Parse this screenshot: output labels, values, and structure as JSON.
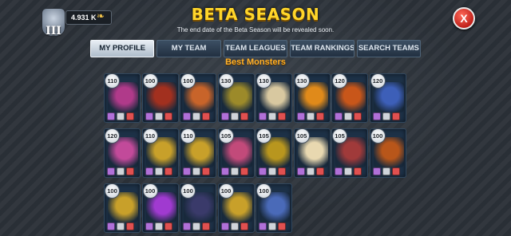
{
  "header": {
    "rank_roman": "III",
    "trophies": "4.931 K",
    "title": "BETA SEASON",
    "subtitle": "The end date of the Beta Season will be revealed soon.",
    "close_label": "X"
  },
  "tabs": [
    {
      "label": "MY PROFILE",
      "active": true
    },
    {
      "label": "MY TEAM",
      "active": false
    },
    {
      "label": "TEAM LEAGUES",
      "active": false
    },
    {
      "label": "TEAM RANKINGS",
      "active": false
    },
    {
      "label": "SEARCH TEAMS",
      "active": false
    }
  ],
  "section_title": "Best Monsters",
  "monsters": [
    {
      "level": "110",
      "color": "#b03a8a"
    },
    {
      "level": "100",
      "color": "#a2301f"
    },
    {
      "level": "100",
      "color": "#c8642a"
    },
    {
      "level": "130",
      "color": "#9c8a2a"
    },
    {
      "level": "130",
      "color": "#d8c8a0"
    },
    {
      "level": "130",
      "color": "#e08a1a"
    },
    {
      "level": "120",
      "color": "#c8561a"
    },
    {
      "level": "120",
      "color": "#3d5fb8"
    },
    {
      "level": "120",
      "color": "#c24a9a"
    },
    {
      "level": "110",
      "color": "#c8a02a"
    },
    {
      "level": "110",
      "color": "#c8a02a"
    },
    {
      "level": "105",
      "color": "#c24a7a"
    },
    {
      "level": "105",
      "color": "#b8961e"
    },
    {
      "level": "105",
      "color": "#e8d8b0"
    },
    {
      "level": "105",
      "color": "#a03a3a"
    },
    {
      "level": "100",
      "color": "#b8561a"
    },
    {
      "level": "100",
      "color": "#c8a02a"
    },
    {
      "level": "100",
      "color": "#a03ad0"
    },
    {
      "level": "100",
      "color": "#3a3a6a"
    },
    {
      "level": "100",
      "color": "#c8a02a"
    },
    {
      "level": "100",
      "color": "#4a6ab8"
    }
  ],
  "icons": {
    "rank": "rank-shield-icon",
    "trophy": "laurel-trophy-icon",
    "close": "close-icon"
  }
}
